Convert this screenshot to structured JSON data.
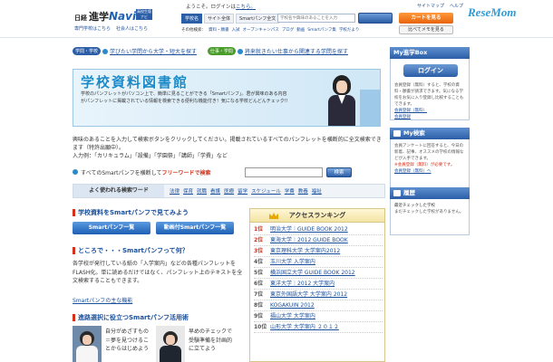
{
  "header": {
    "logo_nikkei": "日経",
    "logo_shingaku": "進学",
    "logo_navi": "Navi",
    "logo_badge": "高校生版ナビ",
    "logo_links": [
      "専門学校はこちら",
      "社会人はこちら"
    ],
    "welcome": "ようこそ。ログインは",
    "welcome_link": "こちら。",
    "top_links": [
      "サイトマップ",
      "ヘルプ"
    ],
    "search_tabs": [
      "学校名",
      "サイト全体",
      "Smartパンフ全文"
    ],
    "search_placeholder": "学校名や興味のあることを入力",
    "search_button": "検索",
    "other_label": "その他検索：",
    "other_links": [
      "資料・願書",
      "入試",
      "オープンキャンパス",
      "ブログ",
      "動画",
      "Smartパンフ集",
      "学校だより"
    ],
    "cart_button": "カートを見る",
    "compare_button": "比べてメモを見る"
  },
  "watermark": "ReseMom",
  "nav": {
    "pill1": "学問・学校",
    "link1": "学びたい学問から大学・短大を探す",
    "pill2": "仕事・学問",
    "link2": "将来就きたい仕事から関連する学問を探す"
  },
  "banner": {
    "title": "学校資料図書館",
    "text": "学校のパンフレットがパソコン上で、簡単に見ることができる「Smartパンフ」。君が興味のある内容がパンフレットに掲載されている情報を検索できる便利な機能付き！気になる学校どんどんチェック!!"
  },
  "intro": {
    "line1": "興味のあることを入力して検索ボタンをクリックしてください。掲載されているすべてのパンフレットを横断的に全文検索できます（特許出願中）。",
    "line2": "入力例：「カリキュラム」「設備」「学園祭」「講師」「学費」など"
  },
  "freeword": {
    "label_pre": "すべてのSmartパンフを横断してフリーワードで検索",
    "label_red": "フリーワードで検索",
    "button": "検索"
  },
  "keywords": {
    "label": "よく使われる検索ワード",
    "items": [
      "法律",
      "保育",
      "就職",
      "看護",
      "医療",
      "留学",
      "スケジュール",
      "学費",
      "教養",
      "福祉"
    ]
  },
  "left": {
    "sec1_title": "学校資料をSmartパンフで見てみよう",
    "btn_smart": "Smartパンフ一覧",
    "btn_video": "動画付Smartパンフ一覧",
    "sec2_title": "ところで・・・Smartパンフって何？",
    "sec2_text": "各学校が発行している紙の「入学案内」などの各種パンフレットをFLASH化。単に読めるだけではなく、パンフレット上のテキストを全文検索することもできます。",
    "sec2_link": "Smartパンフの主な機能",
    "sec3_title": "進路選択に役立つSmartパンフ活用術",
    "thumb1_text": "自分がめざすもの＝夢を見つけることからはじめよう",
    "thumb2_text": "早めのチェックで受験準備を計画的に立てよう"
  },
  "ranking": {
    "title": "アクセスランキング",
    "rows": [
      {
        "num": "1位",
        "name": "明治大学｜GUIDE BOOK 2012"
      },
      {
        "num": "2位",
        "name": "東海大学｜2012 GUIDE BOOK"
      },
      {
        "num": "3位",
        "name": "東京理科大学 大学案内2012"
      },
      {
        "num": "4位",
        "name": "玉川大学 入学案内"
      },
      {
        "num": "5位",
        "name": "横浜国立大学 GUIDE BOOK 2012"
      },
      {
        "num": "6位",
        "name": "東洋大学｜2012 大学案内"
      },
      {
        "num": "7位",
        "name": "東京外国語大学 大学案内 2012"
      },
      {
        "num": "8位",
        "name": "KOGAKUIN 2012"
      },
      {
        "num": "9位",
        "name": "福山大学 大学案内"
      },
      {
        "num": "10位",
        "name": "山形大学 大学案内 ２０１２"
      }
    ]
  },
  "side": {
    "mybox_title": "My進学Box",
    "login_button": "ログイン",
    "login_text": "会員登録（無料）すると、学校の資料・願書が請求できます。気になる学校をお気に入り登録し比較することもできます。",
    "login_links": [
      "会員登録（無料）",
      "会員登録"
    ],
    "mysearch_title": "My検索",
    "mysearch_text": "会員アンケートに回答すると、今日の新着、記事、オススメの学校の情報などが入手できます。",
    "mysearch_note": "※会員登録（無料）が必要です。",
    "mysearch_link": "会員登録（無料）へ",
    "history_title": "履歴",
    "history_sub": "最近チェックした学校",
    "history_text": "まだチェックした学校がありません。"
  }
}
